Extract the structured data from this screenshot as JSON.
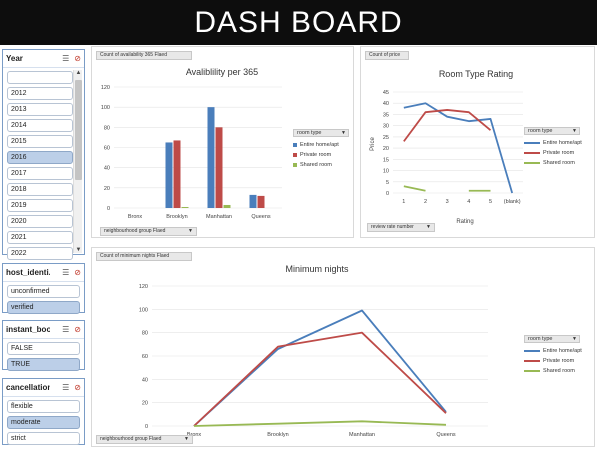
{
  "header": {
    "title": "DASH BOARD"
  },
  "slicers": {
    "year": {
      "title": "Year",
      "blank_item": "",
      "items": [
        "2012",
        "2013",
        "2014",
        "2015",
        "2016",
        "2017",
        "2018",
        "2019",
        "2020",
        "2021",
        "2022"
      ],
      "selected": "2016"
    },
    "host": {
      "title": "host_identi...",
      "items": [
        "unconfirmed",
        "verified"
      ],
      "selected": "verified"
    },
    "instant": {
      "title": "instant_boo...",
      "items": [
        "FALSE",
        "TRUE"
      ],
      "selected": "TRUE"
    },
    "cancel": {
      "title": "cancellation...",
      "items": [
        "flexible",
        "moderate",
        "strict"
      ],
      "selected": "moderate"
    }
  },
  "icons": {
    "multiselect": "multiselect-icon",
    "clear_filter": "clear-filter-icon",
    "filter_dropdown": "filter-dropdown-icon"
  },
  "colors": {
    "entire": "#4a7ebb",
    "private": "#be4b48",
    "shared": "#98b954",
    "header_bg": "#0d0d0d",
    "slicer_selected": "#bccfe8"
  },
  "chart1": {
    "field_value": "Count of availability 365 Flaed",
    "field_axis": "neighbourhood group Flaed",
    "legend_title": "room type",
    "legend": [
      "Entire home/apt",
      "Private room",
      "Shared room"
    ]
  },
  "chart2": {
    "field_value": "Count of price",
    "field_axis": "review rate number",
    "legend_title": "room type",
    "legend": [
      "Entire home/apt",
      "Private room",
      "Shared room"
    ]
  },
  "chart3": {
    "field_value": "Count of minimum nights Flaed",
    "field_axis": "neighbourhood group Flaed",
    "legend_title": "room type",
    "legend": [
      "Entire home/apt",
      "Private room",
      "Shared room"
    ]
  },
  "chart_data": [
    {
      "type": "bar",
      "title": "Avaliblility per 365",
      "categories": [
        "Bronx",
        "Brooklyn",
        "Manhattan",
        "Queens"
      ],
      "series": [
        {
          "name": "Entire home/apt",
          "values": [
            0,
            65,
            100,
            13
          ]
        },
        {
          "name": "Private room",
          "values": [
            0,
            67,
            80,
            12
          ]
        },
        {
          "name": "Shared room",
          "values": [
            0,
            1,
            3,
            0
          ]
        }
      ],
      "ylim": [
        0,
        120
      ],
      "yticks": [
        0,
        20,
        40,
        60,
        80,
        100,
        120
      ],
      "grid": true,
      "legend_position": "right"
    },
    {
      "type": "line",
      "title": "Room Type Rating",
      "categories": [
        "1",
        "2",
        "3",
        "4",
        "5",
        "(blank)"
      ],
      "xlabel": "Rating",
      "ylabel": "Price",
      "series": [
        {
          "name": "Entire home/apt",
          "values": [
            38,
            40,
            34,
            32,
            33,
            0
          ]
        },
        {
          "name": "Private room",
          "values": [
            23,
            36,
            37,
            36,
            28,
            null
          ]
        },
        {
          "name": "Shared room",
          "values": [
            3,
            1,
            null,
            1,
            1,
            null
          ]
        }
      ],
      "ylim": [
        0,
        45
      ],
      "yticks": [
        0,
        5,
        10,
        15,
        20,
        25,
        30,
        35,
        40,
        45
      ],
      "grid": true,
      "legend_position": "right"
    },
    {
      "type": "line",
      "title": "Minimum nights",
      "categories": [
        "Bronx",
        "Brooklyn",
        "Manhattan",
        "Queens"
      ],
      "series": [
        {
          "name": "Entire home/apt",
          "values": [
            0,
            66,
            99,
            12
          ]
        },
        {
          "name": "Private room",
          "values": [
            0,
            68,
            80,
            11
          ]
        },
        {
          "name": "Shared room",
          "values": [
            0,
            2,
            4,
            1
          ]
        }
      ],
      "ylim": [
        0,
        120
      ],
      "yticks": [
        0,
        20,
        40,
        60,
        80,
        100,
        120
      ],
      "grid": true,
      "legend_position": "right"
    }
  ]
}
